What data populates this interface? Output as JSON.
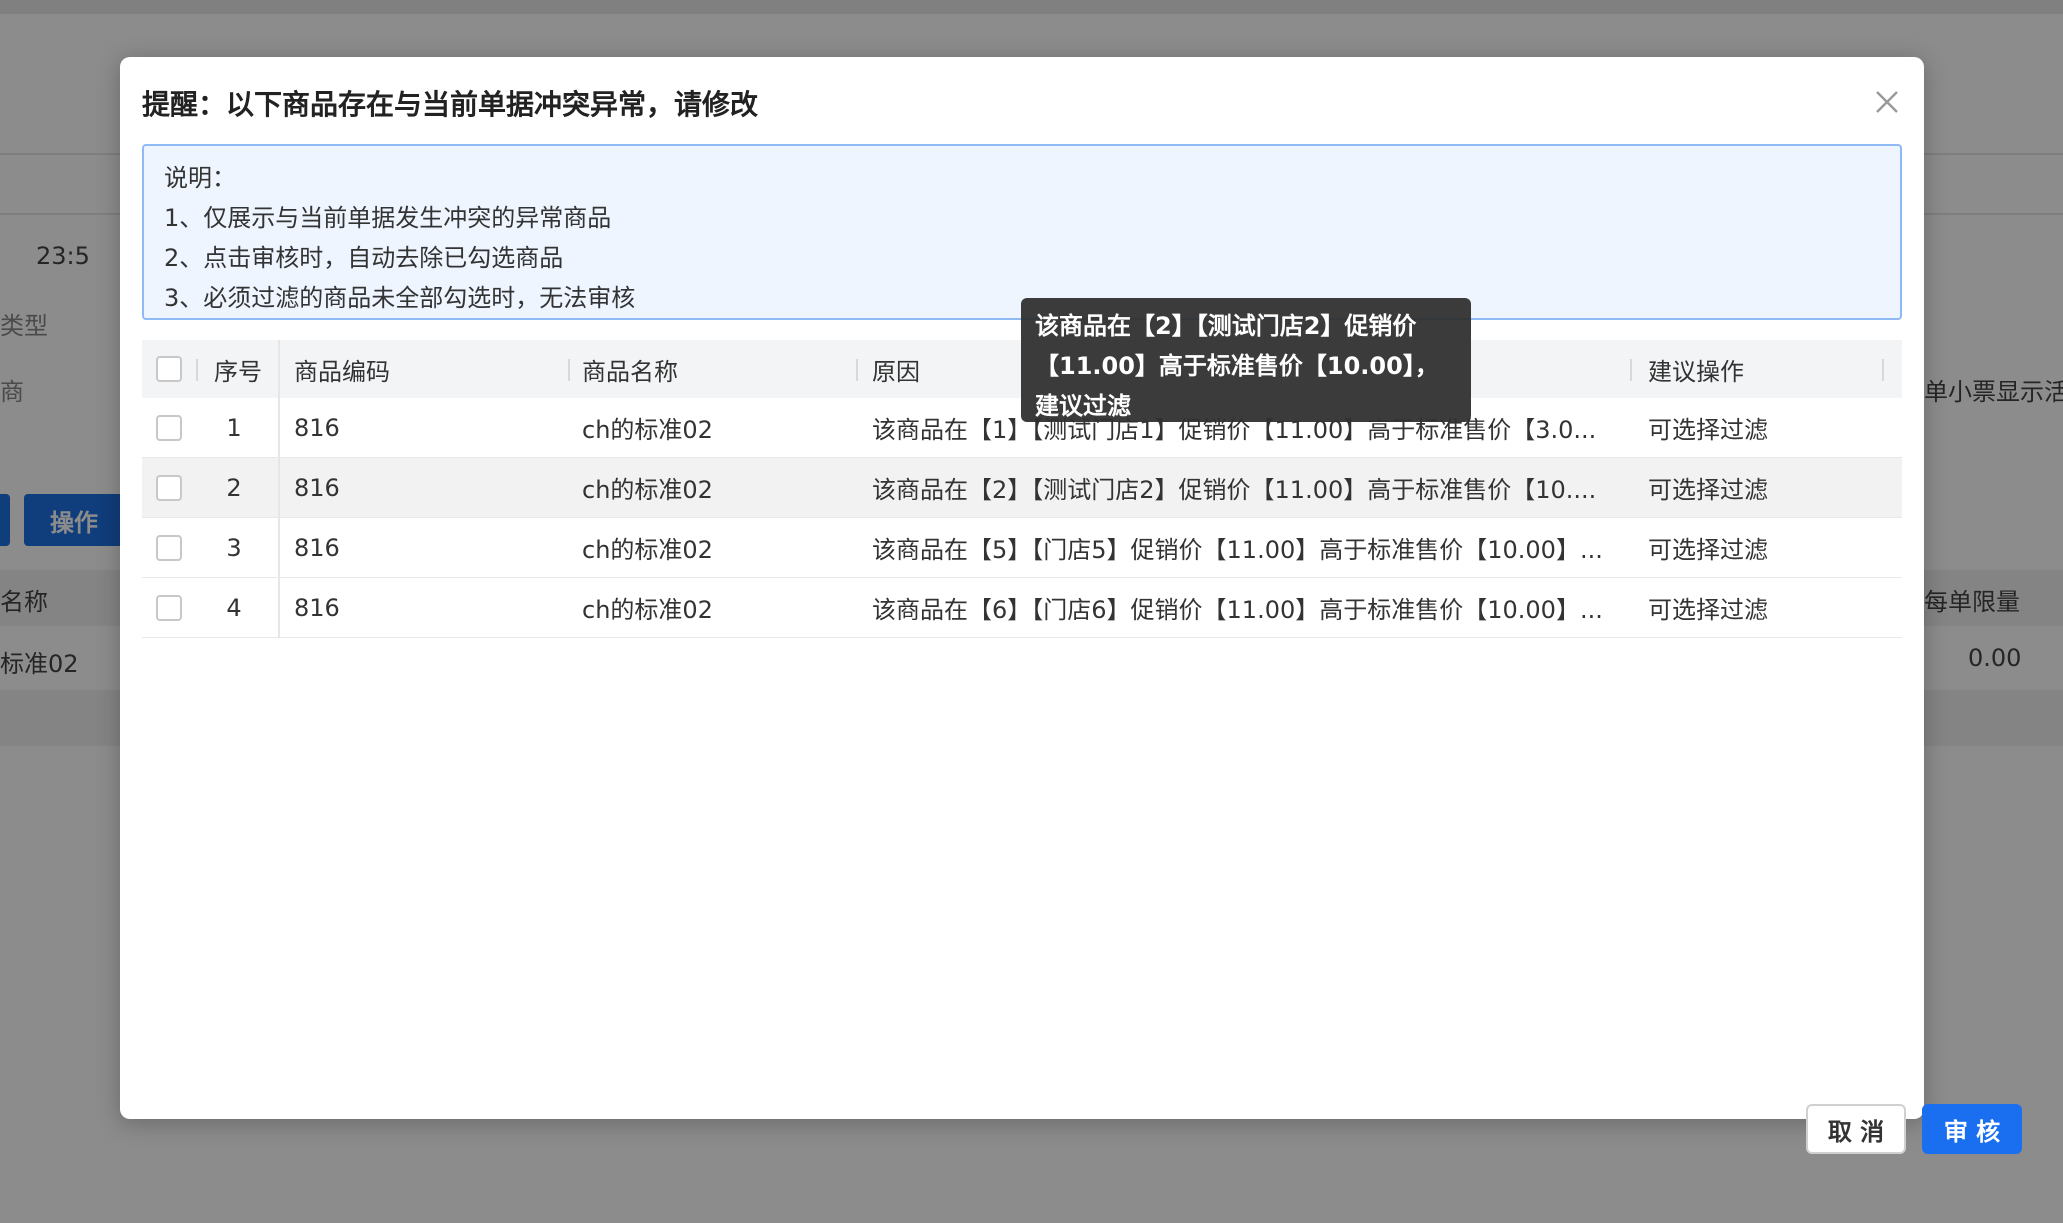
{
  "background": {
    "time_fragment": "23:5",
    "type_label": "类型",
    "merchant_label": "商",
    "operate_button": "操作",
    "name_header": "名称",
    "name_value": "标准02",
    "receipt_label": "单小票显示活",
    "limit_header": "每单限量",
    "limit_value": "0.00"
  },
  "modal": {
    "title": "提醒：以下商品存在与当前单据冲突异常，请修改",
    "notice": {
      "heading": "说明：",
      "lines": [
        "1、仅展示与当前单据发生冲突的异常商品",
        "2、点击审核时，自动去除已勾选商品",
        "3、必须过滤的商品未全部勾选时，无法审核"
      ]
    },
    "table": {
      "columns": [
        "序号",
        "商品编码",
        "商品名称",
        "原因",
        "建议操作"
      ],
      "rows": [
        {
          "index": "1",
          "code": "816",
          "name": "ch的标准02",
          "reason": "该商品在【1】【测试门店1】促销价【11.00】高于标准售价【3.0...",
          "action": "可选择过滤"
        },
        {
          "index": "2",
          "code": "816",
          "name": "ch的标准02",
          "reason": "该商品在【2】【测试门店2】促销价【11.00】高于标准售价【10....",
          "action": "可选择过滤"
        },
        {
          "index": "3",
          "code": "816",
          "name": "ch的标准02",
          "reason": "该商品在【5】【门店5】促销价【11.00】高于标准售价【10.00】...",
          "action": "可选择过滤"
        },
        {
          "index": "4",
          "code": "816",
          "name": "ch的标准02",
          "reason": "该商品在【6】【门店6】促销价【11.00】高于标准售价【10.00】...",
          "action": "可选择过滤"
        }
      ]
    },
    "tooltip": {
      "lines": [
        "该商品在【2】【测试门店2】促销价",
        "【11.00】高于标准售价【10.00】，",
        "建议过滤"
      ]
    },
    "buttons": {
      "cancel": "取 消",
      "approve": "审 核"
    }
  }
}
